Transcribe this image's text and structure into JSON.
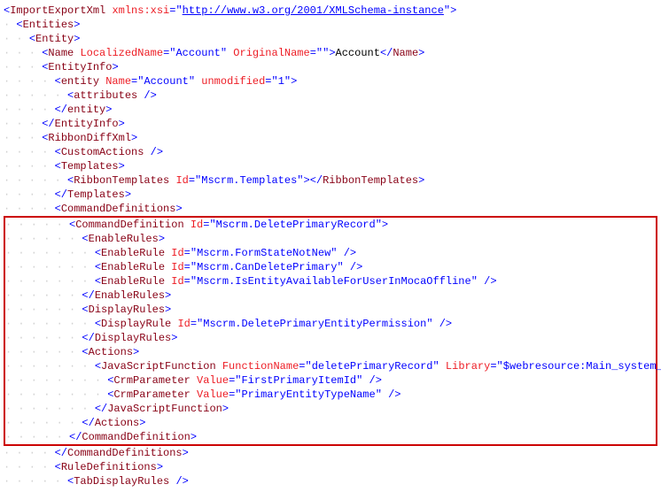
{
  "lines": [
    {
      "guides": "",
      "parts": [
        {
          "t": "punct",
          "v": "<"
        },
        {
          "t": "tag",
          "v": "ImportExportXml"
        },
        {
          "t": "text",
          "v": " "
        },
        {
          "t": "attr",
          "v": "xmlns:xsi"
        },
        {
          "t": "punct",
          "v": "="
        },
        {
          "t": "punct",
          "v": "\""
        },
        {
          "t": "link",
          "v": "http://www.w3.org/2001/XMLSchema-instance"
        },
        {
          "t": "punct",
          "v": "\""
        },
        {
          "t": "punct",
          "v": ">"
        }
      ]
    },
    {
      "guides": "  ",
      "parts": [
        {
          "t": "punct",
          "v": "<"
        },
        {
          "t": "tag",
          "v": "Entities"
        },
        {
          "t": "punct",
          "v": ">"
        }
      ]
    },
    {
      "guides": "    ",
      "parts": [
        {
          "t": "punct",
          "v": "<"
        },
        {
          "t": "tag",
          "v": "Entity"
        },
        {
          "t": "punct",
          "v": ">"
        }
      ]
    },
    {
      "guides": "      ",
      "parts": [
        {
          "t": "punct",
          "v": "<"
        },
        {
          "t": "tag",
          "v": "Name"
        },
        {
          "t": "text",
          "v": " "
        },
        {
          "t": "attr",
          "v": "LocalizedName"
        },
        {
          "t": "punct",
          "v": "=\""
        },
        {
          "t": "val",
          "v": "Account"
        },
        {
          "t": "punct",
          "v": "\" "
        },
        {
          "t": "attr",
          "v": "OriginalName"
        },
        {
          "t": "punct",
          "v": "=\""
        },
        {
          "t": "punct",
          "v": "\""
        },
        {
          "t": "punct",
          "v": ">"
        },
        {
          "t": "text",
          "v": "Account"
        },
        {
          "t": "punct",
          "v": "</"
        },
        {
          "t": "tag",
          "v": "Name"
        },
        {
          "t": "punct",
          "v": ">"
        }
      ]
    },
    {
      "guides": "      ",
      "parts": [
        {
          "t": "punct",
          "v": "<"
        },
        {
          "t": "tag",
          "v": "EntityInfo"
        },
        {
          "t": "punct",
          "v": ">"
        }
      ]
    },
    {
      "guides": "        ",
      "parts": [
        {
          "t": "punct",
          "v": "<"
        },
        {
          "t": "tag",
          "v": "entity"
        },
        {
          "t": "text",
          "v": " "
        },
        {
          "t": "attr",
          "v": "Name"
        },
        {
          "t": "punct",
          "v": "=\""
        },
        {
          "t": "val",
          "v": "Account"
        },
        {
          "t": "punct",
          "v": "\" "
        },
        {
          "t": "attr",
          "v": "unmodified"
        },
        {
          "t": "punct",
          "v": "=\""
        },
        {
          "t": "val",
          "v": "1"
        },
        {
          "t": "punct",
          "v": "\""
        },
        {
          "t": "punct",
          "v": ">"
        }
      ]
    },
    {
      "guides": "          ",
      "parts": [
        {
          "t": "punct",
          "v": "<"
        },
        {
          "t": "tag",
          "v": "attributes"
        },
        {
          "t": "punct",
          "v": " />"
        }
      ]
    },
    {
      "guides": "        ",
      "parts": [
        {
          "t": "punct",
          "v": "</"
        },
        {
          "t": "tag",
          "v": "entity"
        },
        {
          "t": "punct",
          "v": ">"
        }
      ]
    },
    {
      "guides": "      ",
      "parts": [
        {
          "t": "punct",
          "v": "</"
        },
        {
          "t": "tag",
          "v": "EntityInfo"
        },
        {
          "t": "punct",
          "v": ">"
        }
      ]
    },
    {
      "guides": "      ",
      "parts": [
        {
          "t": "punct",
          "v": "<"
        },
        {
          "t": "tag",
          "v": "RibbonDiffXml"
        },
        {
          "t": "punct",
          "v": ">"
        }
      ]
    },
    {
      "guides": "        ",
      "parts": [
        {
          "t": "punct",
          "v": "<"
        },
        {
          "t": "tag",
          "v": "CustomActions"
        },
        {
          "t": "punct",
          "v": " />"
        }
      ]
    },
    {
      "guides": "        ",
      "parts": [
        {
          "t": "punct",
          "v": "<"
        },
        {
          "t": "tag",
          "v": "Templates"
        },
        {
          "t": "punct",
          "v": ">"
        }
      ]
    },
    {
      "guides": "          ",
      "parts": [
        {
          "t": "punct",
          "v": "<"
        },
        {
          "t": "tag",
          "v": "RibbonTemplates"
        },
        {
          "t": "text",
          "v": " "
        },
        {
          "t": "attr",
          "v": "Id"
        },
        {
          "t": "punct",
          "v": "=\""
        },
        {
          "t": "val",
          "v": "Mscrm.Templates"
        },
        {
          "t": "punct",
          "v": "\""
        },
        {
          "t": "punct",
          "v": "></"
        },
        {
          "t": "tag",
          "v": "RibbonTemplates"
        },
        {
          "t": "punct",
          "v": ">"
        }
      ]
    },
    {
      "guides": "        ",
      "parts": [
        {
          "t": "punct",
          "v": "</"
        },
        {
          "t": "tag",
          "v": "Templates"
        },
        {
          "t": "punct",
          "v": ">"
        }
      ]
    },
    {
      "guides": "        ",
      "parts": [
        {
          "t": "punct",
          "v": "<"
        },
        {
          "t": "tag",
          "v": "CommandDefinitions"
        },
        {
          "t": "punct",
          "v": ">"
        }
      ]
    }
  ],
  "highlight_lines": [
    {
      "guides": "          ",
      "parts": [
        {
          "t": "punct",
          "v": "<"
        },
        {
          "t": "tag",
          "v": "CommandDefinition"
        },
        {
          "t": "text",
          "v": " "
        },
        {
          "t": "attr",
          "v": "Id"
        },
        {
          "t": "punct",
          "v": "=\""
        },
        {
          "t": "val",
          "v": "Mscrm.DeletePrimaryRecord"
        },
        {
          "t": "punct",
          "v": "\""
        },
        {
          "t": "punct",
          "v": ">"
        }
      ]
    },
    {
      "guides": "            ",
      "parts": [
        {
          "t": "punct",
          "v": "<"
        },
        {
          "t": "tag",
          "v": "EnableRules"
        },
        {
          "t": "punct",
          "v": ">"
        }
      ]
    },
    {
      "guides": "              ",
      "parts": [
        {
          "t": "punct",
          "v": "<"
        },
        {
          "t": "tag",
          "v": "EnableRule"
        },
        {
          "t": "text",
          "v": " "
        },
        {
          "t": "attr",
          "v": "Id"
        },
        {
          "t": "punct",
          "v": "=\""
        },
        {
          "t": "val",
          "v": "Mscrm.FormStateNotNew"
        },
        {
          "t": "punct",
          "v": "\""
        },
        {
          "t": "punct",
          "v": " />"
        }
      ]
    },
    {
      "guides": "              ",
      "parts": [
        {
          "t": "punct",
          "v": "<"
        },
        {
          "t": "tag",
          "v": "EnableRule"
        },
        {
          "t": "text",
          "v": " "
        },
        {
          "t": "attr",
          "v": "Id"
        },
        {
          "t": "punct",
          "v": "=\""
        },
        {
          "t": "val",
          "v": "Mscrm.CanDeletePrimary"
        },
        {
          "t": "punct",
          "v": "\""
        },
        {
          "t": "punct",
          "v": " />"
        }
      ]
    },
    {
      "guides": "              ",
      "parts": [
        {
          "t": "punct",
          "v": "<"
        },
        {
          "t": "tag",
          "v": "EnableRule"
        },
        {
          "t": "text",
          "v": " "
        },
        {
          "t": "attr",
          "v": "Id"
        },
        {
          "t": "punct",
          "v": "=\""
        },
        {
          "t": "val",
          "v": "Mscrm.IsEntityAvailableForUserInMocaOffline"
        },
        {
          "t": "punct",
          "v": "\""
        },
        {
          "t": "punct",
          "v": " />"
        }
      ]
    },
    {
      "guides": "            ",
      "parts": [
        {
          "t": "punct",
          "v": "</"
        },
        {
          "t": "tag",
          "v": "EnableRules"
        },
        {
          "t": "punct",
          "v": ">"
        }
      ]
    },
    {
      "guides": "            ",
      "parts": [
        {
          "t": "punct",
          "v": "<"
        },
        {
          "t": "tag",
          "v": "DisplayRules"
        },
        {
          "t": "punct",
          "v": ">"
        }
      ]
    },
    {
      "guides": "              ",
      "parts": [
        {
          "t": "punct",
          "v": "<"
        },
        {
          "t": "tag",
          "v": "DisplayRule"
        },
        {
          "t": "text",
          "v": " "
        },
        {
          "t": "attr",
          "v": "Id"
        },
        {
          "t": "punct",
          "v": "=\""
        },
        {
          "t": "val",
          "v": "Mscrm.DeletePrimaryEntityPermission"
        },
        {
          "t": "punct",
          "v": "\""
        },
        {
          "t": "punct",
          "v": " />"
        }
      ]
    },
    {
      "guides": "            ",
      "parts": [
        {
          "t": "punct",
          "v": "</"
        },
        {
          "t": "tag",
          "v": "DisplayRules"
        },
        {
          "t": "punct",
          "v": ">"
        }
      ]
    },
    {
      "guides": "            ",
      "parts": [
        {
          "t": "punct",
          "v": "<"
        },
        {
          "t": "tag",
          "v": "Actions"
        },
        {
          "t": "punct",
          "v": ">"
        }
      ]
    },
    {
      "guides": "              ",
      "parts": [
        {
          "t": "punct",
          "v": "<"
        },
        {
          "t": "tag",
          "v": "JavaScriptFunction"
        },
        {
          "t": "text",
          "v": " "
        },
        {
          "t": "attr",
          "v": "FunctionName"
        },
        {
          "t": "punct",
          "v": "=\""
        },
        {
          "t": "val",
          "v": "deletePrimaryRecord"
        },
        {
          "t": "punct",
          "v": "\" "
        },
        {
          "t": "attr",
          "v": "Library"
        },
        {
          "t": "punct",
          "v": "=\""
        },
        {
          "t": "val",
          "v": "$webresource:Main_system_library.js"
        },
        {
          "t": "punct",
          "v": "\""
        },
        {
          "t": "punct",
          "v": ">"
        }
      ]
    },
    {
      "guides": "                ",
      "parts": [
        {
          "t": "punct",
          "v": "<"
        },
        {
          "t": "tag",
          "v": "CrmParameter"
        },
        {
          "t": "text",
          "v": " "
        },
        {
          "t": "attr",
          "v": "Value"
        },
        {
          "t": "punct",
          "v": "=\""
        },
        {
          "t": "val",
          "v": "FirstPrimaryItemId"
        },
        {
          "t": "punct",
          "v": "\""
        },
        {
          "t": "punct",
          "v": " />"
        }
      ]
    },
    {
      "guides": "                ",
      "parts": [
        {
          "t": "punct",
          "v": "<"
        },
        {
          "t": "tag",
          "v": "CrmParameter"
        },
        {
          "t": "text",
          "v": " "
        },
        {
          "t": "attr",
          "v": "Value"
        },
        {
          "t": "punct",
          "v": "=\""
        },
        {
          "t": "val",
          "v": "PrimaryEntityTypeName"
        },
        {
          "t": "punct",
          "v": "\""
        },
        {
          "t": "punct",
          "v": " />"
        }
      ]
    },
    {
      "guides": "              ",
      "parts": [
        {
          "t": "punct",
          "v": "</"
        },
        {
          "t": "tag",
          "v": "JavaScriptFunction"
        },
        {
          "t": "punct",
          "v": ">"
        }
      ]
    },
    {
      "guides": "            ",
      "parts": [
        {
          "t": "punct",
          "v": "</"
        },
        {
          "t": "tag",
          "v": "Actions"
        },
        {
          "t": "punct",
          "v": ">"
        }
      ]
    },
    {
      "guides": "          ",
      "parts": [
        {
          "t": "punct",
          "v": "</"
        },
        {
          "t": "tag",
          "v": "CommandDefinition"
        },
        {
          "t": "punct",
          "v": ">"
        }
      ]
    }
  ],
  "lines_after": [
    {
      "guides": "        ",
      "parts": [
        {
          "t": "punct",
          "v": "</"
        },
        {
          "t": "tag",
          "v": "CommandDefinitions"
        },
        {
          "t": "punct",
          "v": ">"
        }
      ]
    },
    {
      "guides": "        ",
      "parts": [
        {
          "t": "punct",
          "v": "<"
        },
        {
          "t": "tag",
          "v": "RuleDefinitions"
        },
        {
          "t": "punct",
          "v": ">"
        }
      ]
    },
    {
      "guides": "          ",
      "parts": [
        {
          "t": "punct",
          "v": "<"
        },
        {
          "t": "tag",
          "v": "TabDisplayRules"
        },
        {
          "t": "punct",
          "v": " />"
        }
      ]
    }
  ]
}
